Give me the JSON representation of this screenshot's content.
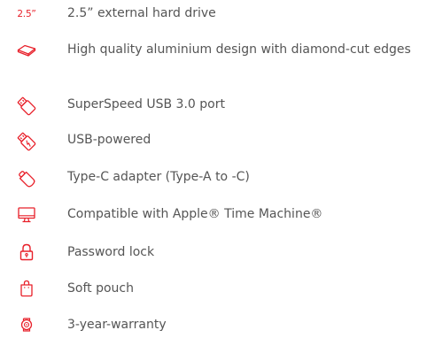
{
  "colors": {
    "accent": "#e8202a",
    "text": "#555555",
    "background": "#ffffff"
  },
  "features": [
    {
      "icon": "size-label-icon",
      "icon_text": "2.5”",
      "label": "2.5” external hard drive"
    },
    {
      "icon": "drive-design-icon",
      "label": "High quality aluminium design with diamond-cut edges"
    },
    {
      "icon": "usb-plug-icon",
      "label": "SuperSpeed USB 3.0 port"
    },
    {
      "icon": "usb-powered-icon",
      "label": "USB-powered"
    },
    {
      "icon": "type-c-adapter-icon",
      "label": "Type-C adapter (Type-A to -C)"
    },
    {
      "icon": "monitor-icon",
      "label": "Compatible with Apple® Time Machine®"
    },
    {
      "icon": "padlock-icon",
      "label": "Password lock"
    },
    {
      "icon": "pouch-icon",
      "label": "Soft pouch"
    },
    {
      "icon": "warranty-seal-icon",
      "label": "3-year-warranty"
    }
  ]
}
